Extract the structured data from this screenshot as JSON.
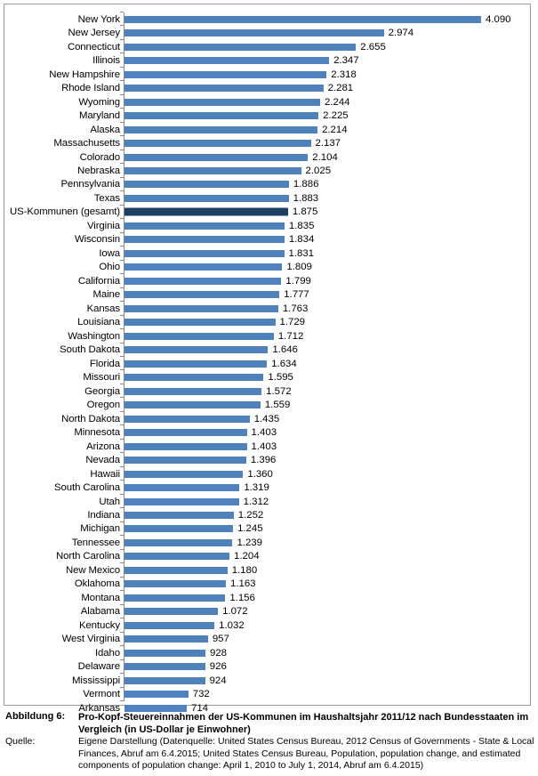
{
  "chart_data": {
    "type": "bar",
    "orientation": "horizontal",
    "title": "",
    "xlabel": "",
    "ylabel": "",
    "grid": false,
    "legend": null,
    "xlim": [
      0,
      4090
    ],
    "value_format": "de-DE thousands separator (.)",
    "highlight_category": "US-Kommunen (gesamt)",
    "colors": {
      "bar": "#4F81BD",
      "bar_highlight": "#1F3E64",
      "axis": "#868686",
      "border": "#9A9A9A",
      "text": "#000000"
    },
    "categories": [
      "New York",
      "New Jersey",
      "Connecticut",
      "Illinois",
      "New Hampshire",
      "Rhode Island",
      "Wyoming",
      "Maryland",
      "Alaska",
      "Massachusetts",
      "Colorado",
      "Nebraska",
      "Pennsylvania",
      "Texas",
      "US-Kommunen (gesamt)",
      "Virginia",
      "Wisconsin",
      "Iowa",
      "Ohio",
      "California",
      "Maine",
      "Kansas",
      "Louisiana",
      "Washington",
      "South Dakota",
      "Florida",
      "Missouri",
      "Georgia",
      "Oregon",
      "North Dakota",
      "Minnesota",
      "Arizona",
      "Nevada",
      "Hawaii",
      "South Carolina",
      "Utah",
      "Indiana",
      "Michigan",
      "Tennessee",
      "North Carolina",
      "New Mexico",
      "Oklahoma",
      "Montana",
      "Alabama",
      "Kentucky",
      "West Virginia",
      "Idaho",
      "Delaware",
      "Mississippi",
      "Vermont",
      "Arkansas"
    ],
    "values": [
      4090,
      2974,
      2655,
      2347,
      2318,
      2281,
      2244,
      2225,
      2214,
      2137,
      2104,
      2025,
      1886,
      1883,
      1875,
      1835,
      1834,
      1831,
      1809,
      1799,
      1777,
      1763,
      1729,
      1712,
      1646,
      1634,
      1595,
      1572,
      1559,
      1435,
      1403,
      1403,
      1396,
      1360,
      1319,
      1312,
      1252,
      1245,
      1239,
      1204,
      1180,
      1163,
      1156,
      1072,
      1032,
      957,
      928,
      926,
      924,
      732,
      714
    ],
    "value_labels": [
      "4.090",
      "2.974",
      "2.655",
      "2.347",
      "2.318",
      "2.281",
      "2.244",
      "2.225",
      "2.214",
      "2.137",
      "2.104",
      "2.025",
      "1.886",
      "1.883",
      "1.875",
      "1.835",
      "1.834",
      "1.831",
      "1.809",
      "1.799",
      "1.777",
      "1.763",
      "1.729",
      "1.712",
      "1.646",
      "1.634",
      "1.595",
      "1.572",
      "1.559",
      "1.435",
      "1.403",
      "1.403",
      "1.396",
      "1.360",
      "1.319",
      "1.312",
      "1.252",
      "1.245",
      "1.239",
      "1.204",
      "1.180",
      "1.163",
      "1.156",
      "1.072",
      "1.032",
      "957",
      "928",
      "926",
      "924",
      "732",
      "714"
    ]
  },
  "caption": {
    "figure_key": "Abbildung 6:",
    "figure_text": "Pro-Kopf-Steuereinnahmen der US-Kommunen im Haushaltsjahr 2011/12 nach Bundesstaaten im Vergleich (in US-Dollar je Einwohner)",
    "source_key": "Quelle:",
    "source_text": "Eigene Darstellung (Datenquelle: United States Census Bureau, 2012 Census of Governments - State & Local Finances, Abruf am 6.4.2015; United States Census Bureau, Population, population change, and estimated components of population change: April 1, 2010 to July 1, 2014, Abruf am 6.4.2015)"
  }
}
